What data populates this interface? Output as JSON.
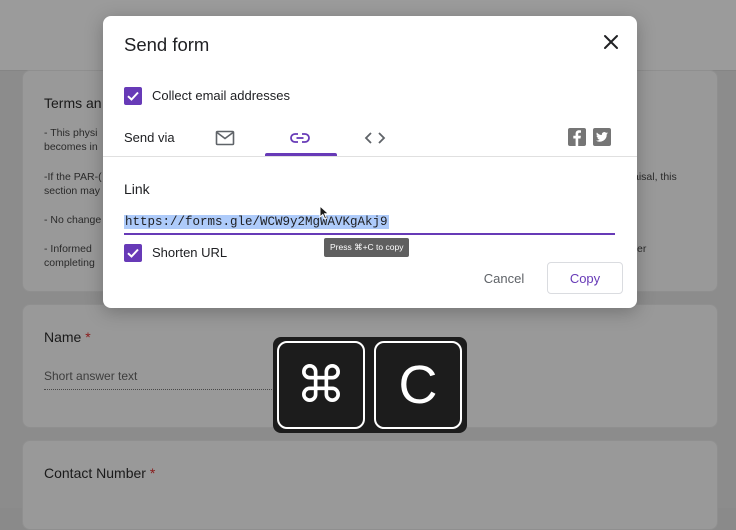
{
  "background": {
    "terms_card": {
      "title": "Terms an",
      "line1a": "- This physi",
      "line1b": "becomes in",
      "line2a": "-If the PAR-(",
      "line2a_right": "aisal, this",
      "line2b": "section may",
      "line3": "- No change",
      "line4a": "- Informed",
      "line4a_right": "er",
      "line4b": "completing"
    },
    "name_card": {
      "title": "Name",
      "required": "*",
      "placeholder": "Short answer text"
    },
    "contact_card": {
      "title": "Contact Number",
      "required": "*"
    }
  },
  "dialog": {
    "title": "Send form",
    "collect_email_label": "Collect email addresses",
    "collect_email_checked": true,
    "send_via_label": "Send via",
    "tabs": [
      {
        "icon": "email-icon",
        "selected": false
      },
      {
        "icon": "link-icon",
        "selected": true
      },
      {
        "icon": "embed-icon",
        "selected": false
      }
    ],
    "social": [
      "facebook-icon",
      "twitter-icon"
    ],
    "link_label": "Link",
    "url_value": "https://forms.gle/WCW9y2MgWAVKgAkj9",
    "shorten_label": "Shorten URL",
    "shorten_checked": true,
    "tooltip": "Press ⌘+C to copy",
    "cancel_label": "Cancel",
    "copy_label": "Copy"
  },
  "keystroke": {
    "key1": "⌘",
    "key2": "C"
  },
  "colors": {
    "accent": "#673ab7",
    "selection": "#aecbfa"
  }
}
